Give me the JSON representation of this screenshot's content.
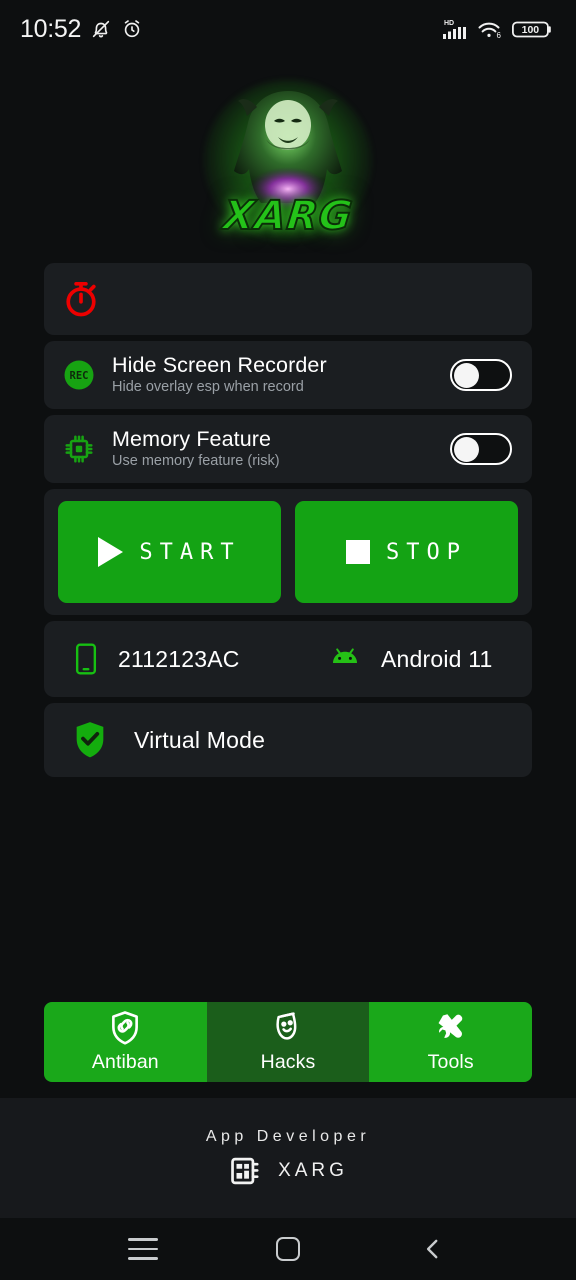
{
  "statusbar": {
    "time": "10:52",
    "left_icons": [
      "mute-bell-icon",
      "alarm-clock-icon"
    ],
    "network_label": "HD",
    "wifi_label": "6",
    "battery_level": "100"
  },
  "logo": {
    "wordmark": "XARG",
    "alt": "xarg-predator-logo",
    "glow_color": "#2bd41b"
  },
  "timer_card": {
    "icon": "stopwatch-icon",
    "icon_color": "#e60000",
    "value": ""
  },
  "toggles": [
    {
      "icon": "rec-icon",
      "icon_text": "REC",
      "title": "Hide Screen Recorder",
      "subtitle": "Hide overlay esp when record",
      "state": "off"
    },
    {
      "icon": "memory-chip-icon",
      "title": "Memory Feature",
      "subtitle": "Use memory feature (risk)",
      "state": "off"
    }
  ],
  "actions": {
    "start_label": "START",
    "stop_label": "STOP",
    "button_color": "#14a314"
  },
  "device": {
    "phone_icon": "smartphone-icon",
    "model": "2112123AC",
    "android_icon": "android-robot-icon",
    "os": "Android 11"
  },
  "virtual_mode": {
    "icon": "shield-check-icon",
    "label": "Virtual Mode"
  },
  "tabs": [
    {
      "label": "Antiban",
      "icon": "shield-link-icon",
      "active": true
    },
    {
      "label": "Hacks",
      "icon": "theater-mask-icon",
      "active": false
    },
    {
      "label": "Tools",
      "icon": "wrench-screwdriver-icon",
      "active": true
    }
  ],
  "footer": {
    "title": "App Developer",
    "icon": "chip-badge-icon",
    "developer": "XARG"
  },
  "navbar": {
    "recents": "menu-icon",
    "home": "home-square-icon",
    "back": "chevron-left-icon"
  }
}
